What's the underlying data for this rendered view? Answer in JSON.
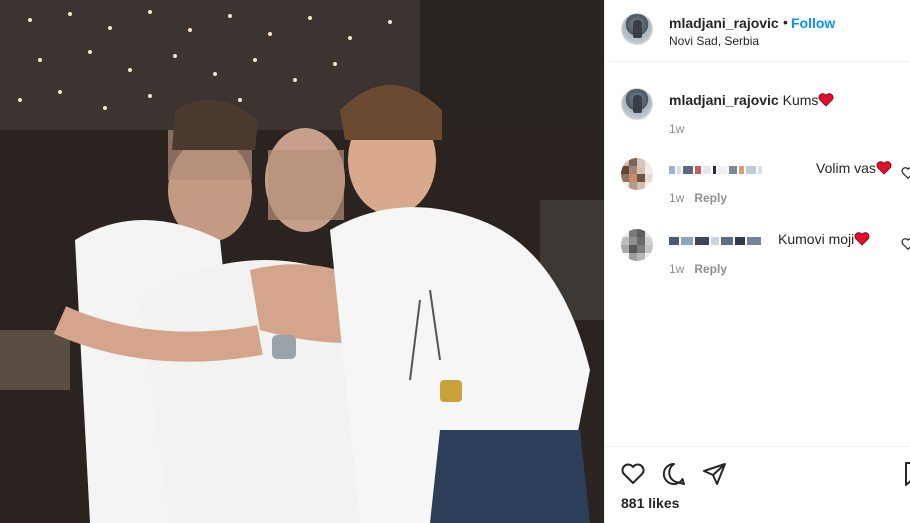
{
  "post": {
    "username": "mladjani_rajovic",
    "follow_label": "Follow",
    "dot": "•",
    "location": "Novi Sad, Serbia"
  },
  "caption": {
    "username": "mladjani_rajovic",
    "text": "Kums",
    "time": "1w"
  },
  "comments": [
    {
      "text": "Volim vas",
      "time": "1w",
      "reply_label": "Reply"
    },
    {
      "text": "Kumovi moji",
      "time": "1w",
      "reply_label": "Reply"
    }
  ],
  "actions": {
    "icons": [
      "heart-icon",
      "comment-icon",
      "share-icon",
      "bookmark-icon"
    ]
  },
  "likes": "881 likes",
  "colors": {
    "accent": "#0095f6",
    "heart": "#ed4956",
    "muted": "#8e8e8e"
  }
}
